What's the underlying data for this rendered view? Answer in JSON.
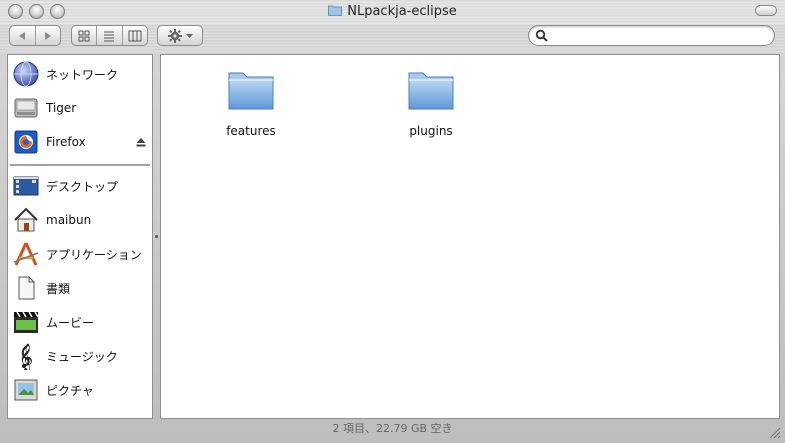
{
  "window": {
    "title": "NLpackja-eclipse"
  },
  "toolbar": {
    "search_placeholder": "",
    "nav": [
      {
        "icon": "back-arrow-icon"
      },
      {
        "icon": "forward-arrow-icon"
      }
    ],
    "view_modes": [
      {
        "icon": "icon-view-icon"
      },
      {
        "icon": "list-view-icon"
      },
      {
        "icon": "column-view-icon"
      }
    ],
    "action_icon": "gear-icon"
  },
  "sidebar": {
    "devices": [
      {
        "label": "ネットワーク",
        "icon": "network-globe-icon"
      },
      {
        "label": "Tiger",
        "icon": "hard-drive-icon"
      },
      {
        "label": "Firefox",
        "icon": "firefox-disk-icon"
      }
    ],
    "places": [
      {
        "label": "デスクトップ",
        "icon": "desktop-icon"
      },
      {
        "label": "maibun",
        "icon": "home-icon"
      },
      {
        "label": "アプリケーション",
        "icon": "applications-icon"
      },
      {
        "label": "書類",
        "icon": "documents-icon"
      },
      {
        "label": "ムービー",
        "icon": "movies-icon"
      },
      {
        "label": "ミュージック",
        "icon": "music-icon"
      },
      {
        "label": "ピクチャ",
        "icon": "pictures-icon"
      }
    ]
  },
  "files": [
    {
      "name": "features",
      "icon": "folder-icon"
    },
    {
      "name": "plugins",
      "icon": "folder-icon"
    }
  ],
  "status": {
    "text": "2 項目、22.79 GB 空き"
  },
  "colors": {
    "folder_blue": "#7fb2e6",
    "window_gray": "#d2d2d2"
  }
}
